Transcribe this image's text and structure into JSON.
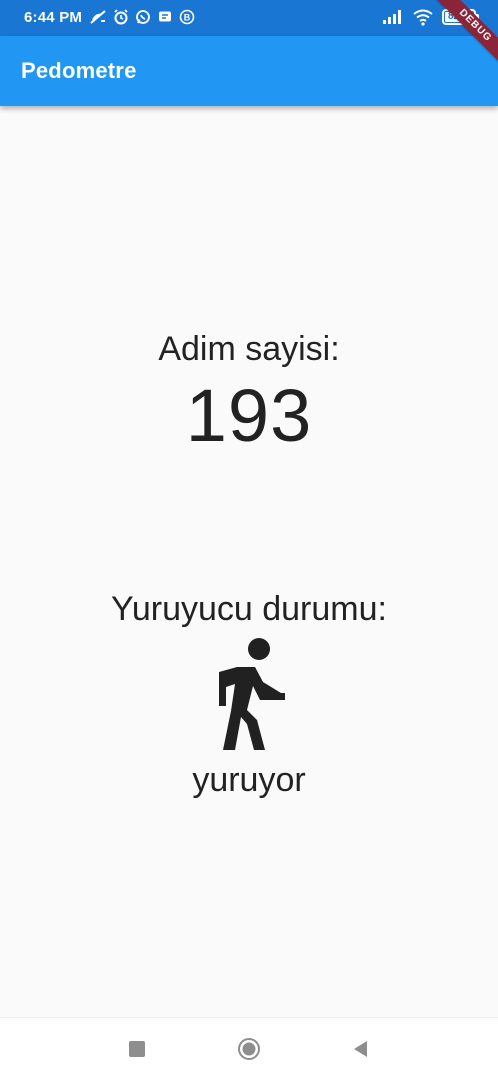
{
  "status_bar": {
    "time": "6:44 PM",
    "battery_level": 0.82,
    "battery_text": "82",
    "colors": {
      "background": "#1976d2"
    },
    "icons": [
      "muted-alarm-icon",
      "alarm-clock-icon",
      "whatsapp-icon",
      "message-icon",
      "notification-b-icon",
      "signal-icon",
      "wifi-icon",
      "battery-icon"
    ]
  },
  "app_bar": {
    "title": "Pedometre",
    "color": "#2196f3"
  },
  "debug_banner": "DEBUG",
  "steps": {
    "label": "Adim sayisi:",
    "value": "193"
  },
  "pedestrian": {
    "label": "Yuruyucu durumu:",
    "icon": "walking-person-icon",
    "status": "yuruyor"
  },
  "navigation_bar": {
    "buttons": [
      "recent-apps-icon",
      "home-icon",
      "back-icon"
    ]
  }
}
